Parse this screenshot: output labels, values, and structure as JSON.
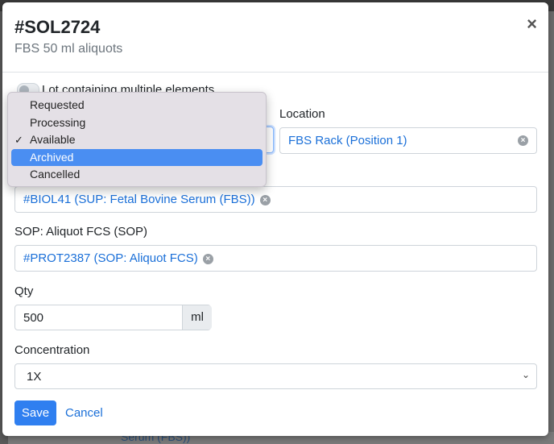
{
  "modal": {
    "title": "#SOL2724",
    "subtitle": "FBS 50 ml aliquots",
    "close_icon": "×"
  },
  "toggle": {
    "label": "Lot containing multiple elements",
    "checked": false
  },
  "location": {
    "label": "Location",
    "value": "FBS Rack (Position 1)"
  },
  "status_dropdown": {
    "options": [
      {
        "label": "Requested",
        "checked": false,
        "highlighted": false
      },
      {
        "label": "Processing",
        "checked": false,
        "highlighted": false
      },
      {
        "label": "Available",
        "checked": true,
        "highlighted": false
      },
      {
        "label": "Archived",
        "checked": false,
        "highlighted": true
      },
      {
        "label": "Cancelled",
        "checked": false,
        "highlighted": false
      }
    ],
    "check_glyph": "✓"
  },
  "biological": {
    "value": "#BIOL41 (SUP: Fetal Bovine Serum (FBS))"
  },
  "sop": {
    "label": "SOP: Aliquot FCS (SOP)",
    "value": "#PROT2387 (SOP: Aliquot FCS)"
  },
  "qty": {
    "label": "Qty",
    "value": "500",
    "unit": "ml"
  },
  "concentration": {
    "label": "Concentration",
    "value": "1X"
  },
  "actions": {
    "save_label": "Save",
    "cancel_label": "Cancel"
  },
  "background": {
    "partial_text": "Serum (FBS))"
  },
  "colors": {
    "accent": "#2f7ff0",
    "link": "#1a6fd8",
    "highlight": "#4a8ef2"
  }
}
